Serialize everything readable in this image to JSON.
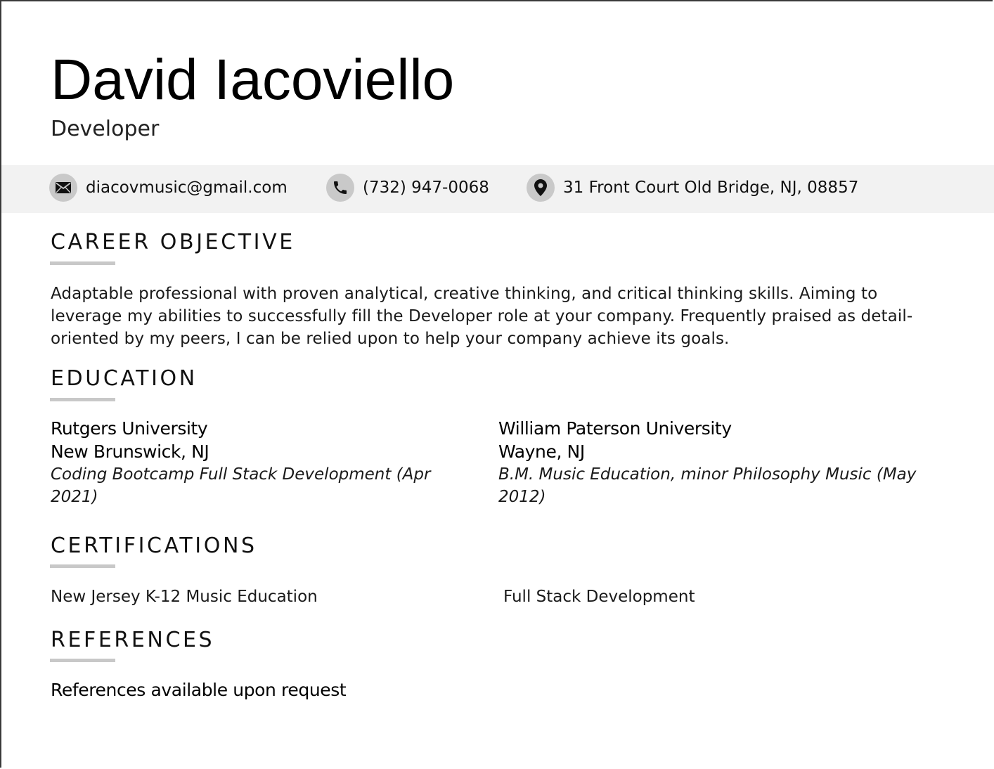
{
  "header": {
    "name": "David Iacoviello",
    "role": "Developer"
  },
  "contact": {
    "email": {
      "icon": "envelope-icon",
      "text": "diacovmusic@gmail.com"
    },
    "phone": {
      "icon": "phone-icon",
      "text": "(732) 947-0068"
    },
    "address": {
      "icon": "map-pin-icon",
      "text": "31 Front Court Old Bridge, NJ, 08857"
    }
  },
  "career_objective": {
    "heading": "CAREER OBJECTIVE",
    "text": "Adaptable professional with proven analytical, creative thinking, and critical thinking skills. Aiming to leverage my abilities to successfully fill the Developer role at your company. Frequently praised as detail-oriented by my peers, I can be relied upon to help your company achieve its goals."
  },
  "education": {
    "heading": "EDUCATION",
    "entries": [
      {
        "school": "Rutgers University",
        "location": "New Brunswick, NJ",
        "degree": "Coding Bootcamp Full Stack Development (Apr 2021)"
      },
      {
        "school": "William Paterson University",
        "location": "Wayne, NJ",
        "degree": "B.M. Music Education, minor Philosophy Music (May 2012)"
      }
    ]
  },
  "certifications": {
    "heading": "CERTIFICATIONS",
    "items": [
      "New Jersey K-12 Music Education",
      "Full Stack Development"
    ]
  },
  "references": {
    "heading": "REFERENCES",
    "text": "References available upon request"
  },
  "colors": {
    "contact_bar": "#f2f2f2",
    "icon_circle": "#c9c9c9",
    "heading_rule": "#c8c8c8"
  }
}
